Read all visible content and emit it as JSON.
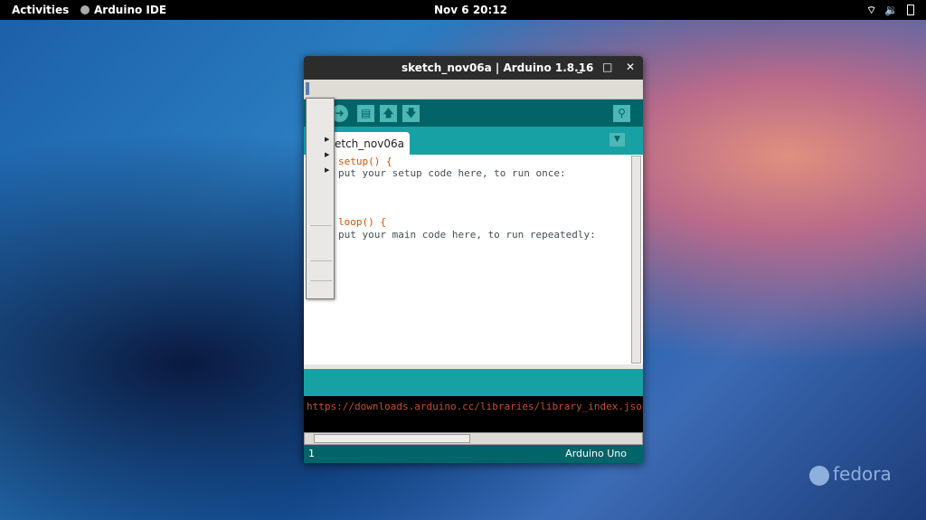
{
  "topbar": {
    "activities": "Activities",
    "app": "Arduino IDE",
    "clock": "Nov 6  20:12"
  },
  "window": {
    "title": "sketch_nov06a | Arduino 1.8.16",
    "minimize": "_",
    "maximize": "□",
    "close": "✕"
  },
  "tab": {
    "label": "etch_nov06a"
  },
  "code": {
    "l1": "setup() {",
    "l2": "put your setup code here, to run once:",
    "l3": "loop() {",
    "l4": "put your main code here, to run repeatedly:"
  },
  "console": {
    "text": "https://downloads.arduino.cc/libraries/library_index.json"
  },
  "status": {
    "line": "1",
    "board": "Arduino Uno"
  },
  "desktop": {
    "logo": "fedora"
  },
  "colors": {
    "teal": "#17a1a5",
    "dark_teal": "#006468",
    "console_text": "#c0522e"
  }
}
